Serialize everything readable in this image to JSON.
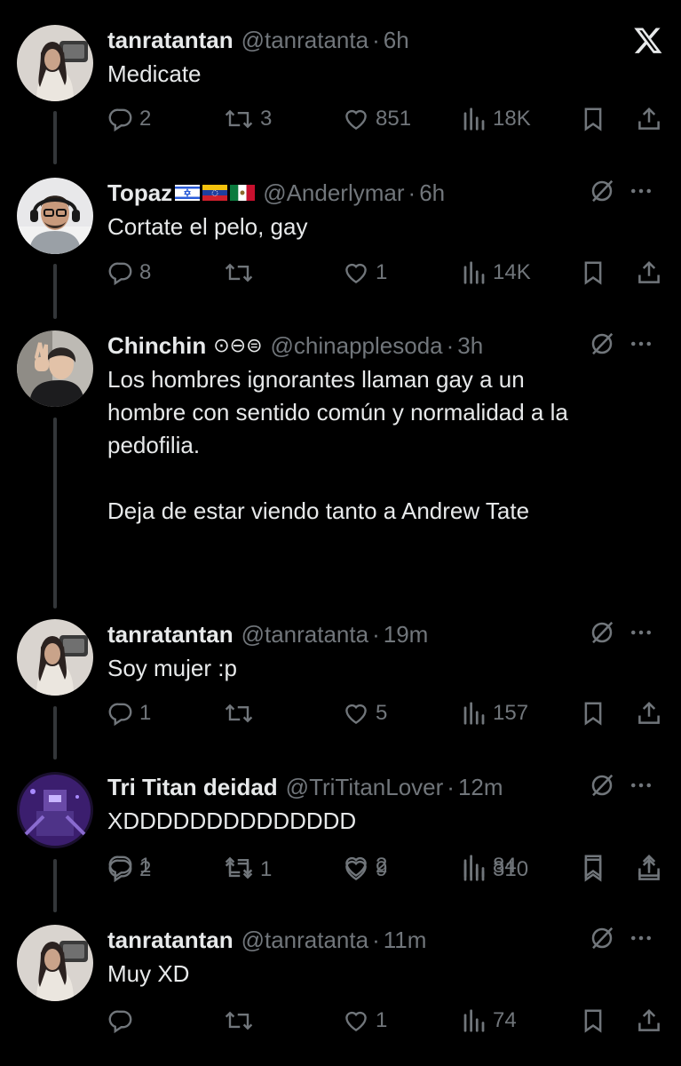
{
  "colors": {
    "background": "#000000",
    "text": "#e7e9ea",
    "muted": "#71767b",
    "thread_line": "#333639"
  },
  "app": {
    "logo_icon": "x-logo-icon"
  },
  "tweets": [
    {
      "name": "tanratantan",
      "handle": "@tanratanta",
      "dot": "·",
      "time": "6h",
      "text": "Medicate",
      "replies": "2",
      "reposts": "3",
      "likes": "851",
      "views": "18K"
    },
    {
      "name": "Topaz",
      "flags": [
        "israel-flag",
        "venezuela-flag",
        "mexico-flag"
      ],
      "handle": "@Anderlymar",
      "dot": "·",
      "time": "6h",
      "text": "Cortate el pelo, gay",
      "replies": "8",
      "reposts": "",
      "likes": "1",
      "views": "14K"
    },
    {
      "name": "Chinchin",
      "badges": "⊙⊖⊜",
      "handle": "@chinapplesoda",
      "dot": "·",
      "time": "3h",
      "text": "Los hombres ignorantes llaman gay a un\nhombre con sentido común y normalidad a la\npedofilia.\n\nDeja de estar viendo tanto a Andrew Tate",
      "replies": "2",
      "reposts": "1",
      "likes": "9",
      "views": "310"
    },
    {
      "name": "tanratantan",
      "handle": "@tanratanta",
      "dot": "·",
      "time": "19m",
      "text": "Soy mujer :p",
      "replies": "1",
      "reposts": "",
      "likes": "5",
      "views": "157"
    },
    {
      "name": "Tri Titan deidad",
      "handle": "@TriTitanLover",
      "dot": "·",
      "time": "12m",
      "text": "XDDDDDDDDDDDDDD",
      "replies": "1",
      "reposts": "",
      "likes": "2",
      "views": "84"
    },
    {
      "name": "tanratantan",
      "handle": "@tanratanta",
      "dot": "·",
      "time": "11m",
      "text": "Muy XD",
      "replies": "",
      "reposts": "",
      "likes": "1",
      "views": "74"
    }
  ]
}
